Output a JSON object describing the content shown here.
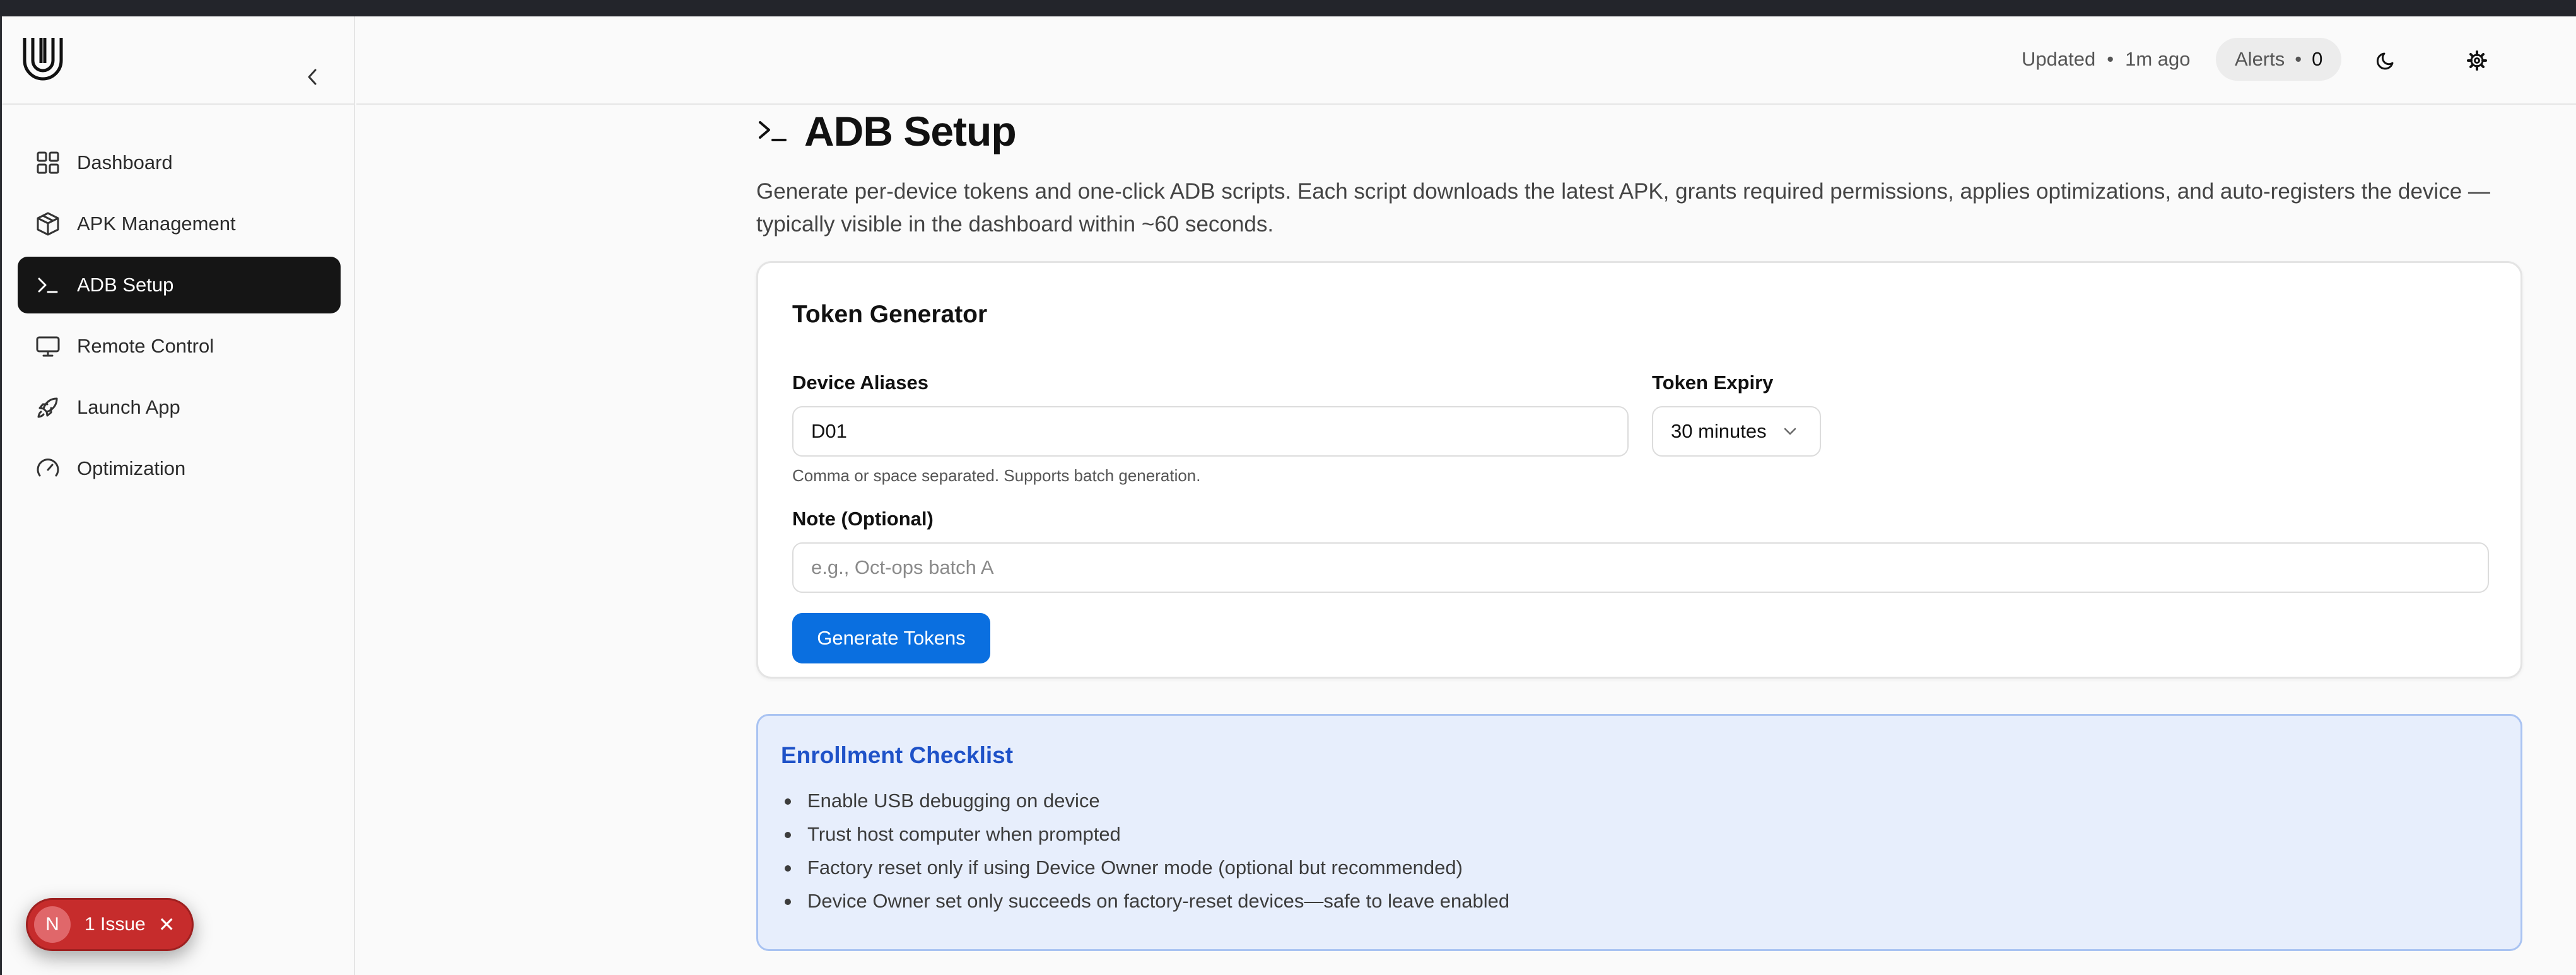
{
  "sidebar": {
    "collapse_label": "Collapse sidebar",
    "items": [
      {
        "label": "Dashboard",
        "icon": "grid-icon"
      },
      {
        "label": "APK Management",
        "icon": "package-icon"
      },
      {
        "label": "ADB Setup",
        "icon": "terminal-icon",
        "active": true
      },
      {
        "label": "Remote Control",
        "icon": "monitor-icon"
      },
      {
        "label": "Launch App",
        "icon": "rocket-icon"
      },
      {
        "label": "Optimization",
        "icon": "gauge-icon"
      }
    ]
  },
  "header": {
    "updated_label": "Updated",
    "separator": "•",
    "updated_time": "1m ago",
    "alerts_label": "Alerts",
    "alerts_count": "0"
  },
  "page": {
    "title": "ADB Setup",
    "description": "Generate per-device tokens and one-click ADB scripts. Each script downloads the latest APK, grants required permissions, applies optimizations, and auto-registers the device —typically visible in the dashboard within ~60 seconds."
  },
  "token_generator": {
    "title": "Token Generator",
    "aliases_label": "Device Aliases",
    "aliases_value": "D01",
    "aliases_hint": "Comma or space separated. Supports batch generation.",
    "expiry_label": "Token Expiry",
    "expiry_value": "30 minutes",
    "note_label": "Note (Optional)",
    "note_placeholder": "e.g., Oct-ops batch A",
    "generate_button": "Generate Tokens"
  },
  "checklist": {
    "title": "Enrollment Checklist",
    "items": [
      "Enable USB debugging on device",
      "Trust host computer when prompted",
      "Factory reset only if using Device Owner mode (optional but recommended)",
      "Device Owner set only succeeds on factory-reset devices—safe to leave enabled"
    ]
  },
  "issue_badge": {
    "avatar_letter": "N",
    "label": "1 Issue"
  },
  "colors": {
    "accent_blue": "#0a6fe0",
    "active_nav": "#151515",
    "checklist_bg": "#e7eefc",
    "checklist_title": "#1f52c8",
    "issue_red": "#c62c2c"
  }
}
